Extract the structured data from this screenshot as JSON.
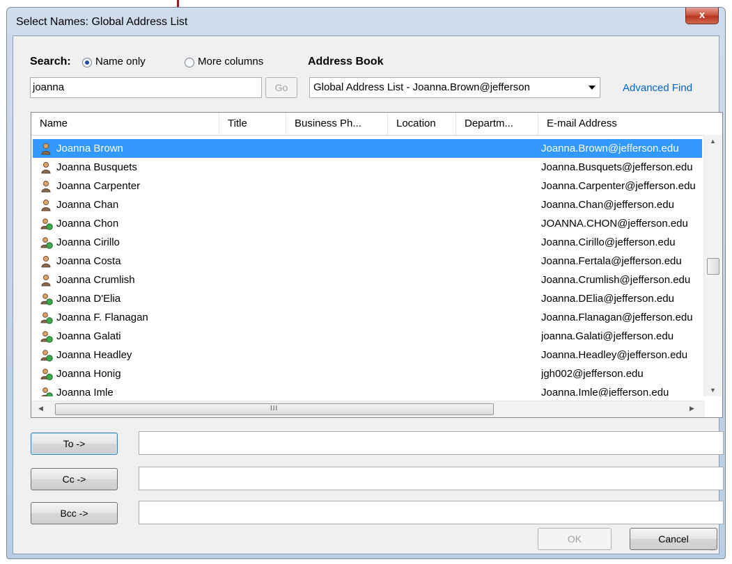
{
  "window": {
    "title": "Select Names: Global Address List",
    "close_label": "x"
  },
  "search": {
    "label": "Search:",
    "name_only_label": "Name only",
    "more_columns_label": "More columns",
    "name_only_selected": true,
    "query": "joanna",
    "go_label": "Go"
  },
  "address_book": {
    "label": "Address Book",
    "selected": "Global Address List - Joanna.Brown@jefferson",
    "advanced_find_label": "Advanced Find"
  },
  "list": {
    "columns": [
      "Name",
      "Title",
      "Business Ph...",
      "Location",
      "Departm...",
      "E-mail Address"
    ],
    "selected_index": 0,
    "rows": [
      {
        "name": "Joanna Brown",
        "email": "Joanna.Brown@jefferson.edu",
        "icon": "user-icon"
      },
      {
        "name": "Joanna Busquets",
        "email": "Joanna.Busquets@jefferson.edu",
        "icon": "user-icon"
      },
      {
        "name": "Joanna Carpenter",
        "email": "Joanna.Carpenter@jefferson.edu",
        "icon": "user-icon"
      },
      {
        "name": "Joanna Chan",
        "email": "Joanna.Chan@jefferson.edu",
        "icon": "user-icon"
      },
      {
        "name": "Joanna Chon",
        "email": "JOANNA.CHON@jefferson.edu",
        "icon": "mail-user-icon"
      },
      {
        "name": "Joanna Cirillo",
        "email": "Joanna.Cirillo@jefferson.edu",
        "icon": "mail-user-icon"
      },
      {
        "name": "Joanna Costa",
        "email": "Joanna.Fertala@jefferson.edu",
        "icon": "user-icon"
      },
      {
        "name": "Joanna Crumlish",
        "email": "Joanna.Crumlish@jefferson.edu",
        "icon": "user-icon"
      },
      {
        "name": "Joanna D'Elia",
        "email": "Joanna.DElia@jefferson.edu",
        "icon": "mail-user-icon"
      },
      {
        "name": "Joanna F. Flanagan",
        "email": "Joanna.Flanagan@jefferson.edu",
        "icon": "mail-user-icon"
      },
      {
        "name": "Joanna Galati",
        "email": "joanna.Galati@jefferson.edu",
        "icon": "mail-user-icon"
      },
      {
        "name": "Joanna Headley",
        "email": "Joanna.Headley@jefferson.edu",
        "icon": "mail-user-icon"
      },
      {
        "name": "Joanna Honig",
        "email": "jgh002@jefferson.edu",
        "icon": "mail-user-icon"
      },
      {
        "name": "Joanna Imle",
        "email": "Joanna.Imle@jefferson.edu",
        "icon": "mail-user-icon"
      }
    ],
    "hscroll_grip": "III"
  },
  "recipients": {
    "to_label": "To ->",
    "cc_label": "Cc ->",
    "bcc_label": "Bcc ->",
    "to_value": "",
    "cc_value": "",
    "bcc_value": ""
  },
  "footer": {
    "ok_label": "OK",
    "cancel_label": "Cancel"
  },
  "colors": {
    "selection": "#3399ff",
    "link": "#0066cc",
    "marker": "#a31221"
  }
}
